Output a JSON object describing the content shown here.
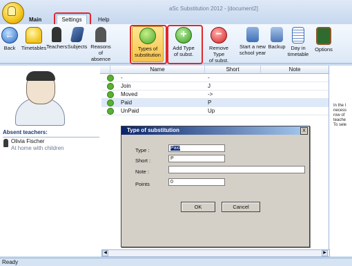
{
  "window": {
    "title": "aSc Substitution 2012 - [document2]"
  },
  "tabs": {
    "main": "Main",
    "settings": "Settings",
    "help": "Help"
  },
  "ribbon": {
    "back": "Back",
    "timetables": "Timetables",
    "teachers": "Teachers",
    "subjects": "Subjects",
    "reasons_1": "Reasons of",
    "reasons_2": "absence",
    "types_1": "Types of",
    "types_2": "substitution",
    "addtype_1": "Add Type",
    "addtype_2": "of subst.",
    "removetype_1": "Remove Type",
    "removetype_2": "of subst.",
    "newyear_1": "Start a new",
    "newyear_2": "school year",
    "backup": "Backup",
    "dayin_1": "Day in",
    "dayin_2": "timetable",
    "options": "Options"
  },
  "left": {
    "absent_header": "Absent teachers:",
    "teacher_name": "Olivia Fischer",
    "teacher_status": "At home with children"
  },
  "grid": {
    "headers": {
      "name": "Name",
      "short": "Short",
      "note": "Note"
    },
    "rows": [
      {
        "name": "-",
        "short": "-"
      },
      {
        "name": "Join",
        "short": "J"
      },
      {
        "name": "Moved",
        "short": "->"
      },
      {
        "name": "Paid",
        "short": "P"
      },
      {
        "name": "UnPaid",
        "short": "Up"
      }
    ]
  },
  "right_text": {
    "l1": "In the l",
    "l2": "necess",
    "l3": "row of",
    "l4": "teache",
    "l5": "To sele"
  },
  "dialog": {
    "title": "Type of substitution",
    "close": "X",
    "type_label": "Type :",
    "type_value": "Paid",
    "short_label": "Short :",
    "short_value": "P",
    "note_label": "Note :",
    "note_value": "",
    "points_label": "Points",
    "points_value": "0",
    "ok": "OK",
    "cancel": "Cancel"
  },
  "status": {
    "text": "Ready"
  },
  "colors": {
    "highlight": "#e0262b",
    "active_tab": "#f7c24a",
    "dialog_title": "#0a246a"
  }
}
